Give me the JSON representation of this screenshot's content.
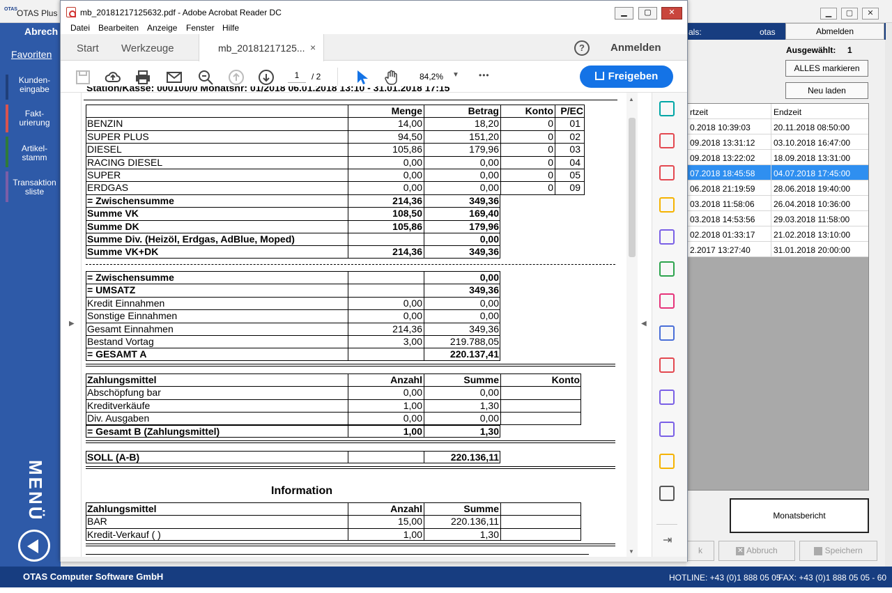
{
  "otas": {
    "window_title": "OTAS Plus",
    "logo_text": "OTAS",
    "section_title": "Abrech",
    "favoriten": "Favoriten",
    "nav": [
      {
        "label": "Kunden-\neingabe",
        "color": "#2e5aa8"
      },
      {
        "label": "Fakt-\nurierung",
        "color": "#d9534f"
      },
      {
        "label": "Artikel-\nstamm",
        "color": "#3c8d3c"
      },
      {
        "label": "Transaktion\nsliste",
        "color": "#7b5ea7"
      }
    ],
    "menu_label": "MENÜ",
    "topbar_als": "als:",
    "topbar_user": "otas",
    "abmelden": "Abmelden",
    "ausgewaehlt_label": "Ausgewählt:",
    "ausgewaehlt_count": "1",
    "alles_markieren": "ALLES markieren",
    "neu_laden": "Neu laden",
    "table_headers": [
      "rtzeit",
      "Endzeit"
    ],
    "table_rows": [
      [
        "0.2018 10:39:03",
        "20.11.2018 08:50:00"
      ],
      [
        "09.2018 13:31:12",
        "03.10.2018 16:47:00"
      ],
      [
        "09.2018 13:22:02",
        "18.09.2018 13:31:00"
      ],
      [
        "07.2018 18:45:58",
        "04.07.2018 17:45:00"
      ],
      [
        "06.2018 21:19:59",
        "28.06.2018 19:40:00"
      ],
      [
        "03.2018 11:58:06",
        "26.04.2018 10:36:00"
      ],
      [
        "03.2018 14:53:56",
        "29.03.2018 11:58:00"
      ],
      [
        "02.2018 01:33:17",
        "21.02.2018 13:10:00"
      ],
      [
        "2.2017 13:27:40",
        "31.01.2018 20:00:00"
      ]
    ],
    "selected_row": 3,
    "monatsbericht": "Monatsbericht",
    "bottom_buttons": [
      "k",
      "Abbruch",
      "Speichern"
    ],
    "company": "OTAS Computer Software GmbH",
    "hotline": "HOTLINE: +43 (0)1 888 05 05",
    "fax": "FAX: +43 (0)1 888 05 05 - 60"
  },
  "acrobat": {
    "title": "mb_20181217125632.pdf - Adobe Acrobat Reader DC",
    "menus": [
      "Datei",
      "Bearbeiten",
      "Anzeige",
      "Fenster",
      "Hilfe"
    ],
    "tabs": {
      "start": "Start",
      "werkzeuge": "Werkzeuge",
      "doc": "mb_20181217125...",
      "close": "×"
    },
    "help": "?",
    "anmelden": "Anmelden",
    "page_current": "1",
    "page_total": "/ 2",
    "zoom": "84,2%",
    "share": "Freigeben",
    "more": "•••"
  },
  "pdf": {
    "cut_header": "Station/Kasse: 000100/0          Monatsnr: 01/2018          06.01.2018 13:10 - 31.01.2018 17:15",
    "t1_headers": {
      "menge": "Menge",
      "betrag": "Betrag",
      "konto": "Konto",
      "pec": "P/EC"
    },
    "t1_rows": [
      {
        "name": "BENZIN",
        "menge": "14,00",
        "betrag": "18,20",
        "konto": "0",
        "pec": "01"
      },
      {
        "name": "SUPER PLUS",
        "menge": "94,50",
        "betrag": "151,20",
        "konto": "0",
        "pec": "02"
      },
      {
        "name": "DIESEL",
        "menge": "105,86",
        "betrag": "179,96",
        "konto": "0",
        "pec": "03"
      },
      {
        "name": "RACING DIESEL",
        "menge": "0,00",
        "betrag": "0,00",
        "konto": "0",
        "pec": "04"
      },
      {
        "name": "SUPER",
        "menge": "0,00",
        "betrag": "0,00",
        "konto": "0",
        "pec": "05"
      },
      {
        "name": "ERDGAS",
        "menge": "0,00",
        "betrag": "0,00",
        "konto": "0",
        "pec": "09"
      }
    ],
    "t1_sums": [
      {
        "name": "= Zwischensumme",
        "menge": "214,36",
        "betrag": "349,36"
      },
      {
        "name": "Summe VK",
        "menge": "108,50",
        "betrag": "169,40"
      },
      {
        "name": "Summe DK",
        "menge": "105,86",
        "betrag": "179,96"
      },
      {
        "name": "Summe Div. (Heizöl, Erdgas, AdBlue, Moped)",
        "menge": "",
        "betrag": "0,00"
      },
      {
        "name": "Summe VK+DK",
        "menge": "214,36",
        "betrag": "349,36"
      }
    ],
    "t2_rows": [
      {
        "name": "= Zwischensumme",
        "menge": "",
        "betrag": "0,00",
        "bold": true
      },
      {
        "name": "= UMSATZ",
        "menge": "",
        "betrag": "349,36",
        "bold": true
      },
      {
        "name": "Kredit Einnahmen",
        "menge": "0,00",
        "betrag": "0,00",
        "bold": false
      },
      {
        "name": "Sonstige Einnahmen",
        "menge": "0,00",
        "betrag": "0,00",
        "bold": false
      },
      {
        "name": "Gesamt Einnahmen",
        "menge": "214,36",
        "betrag": "349,36",
        "bold": false
      },
      {
        "name": "Bestand Vortag",
        "menge": "3,00",
        "betrag": "219.788,05",
        "bold": false
      },
      {
        "name": "= GESAMT A",
        "menge": "",
        "betrag": "220.137,41",
        "bold": true
      }
    ],
    "t3_headers": {
      "name": "Zahlungsmittel",
      "anzahl": "Anzahl",
      "summe": "Summe",
      "konto": "Konto"
    },
    "t3_rows": [
      {
        "name": "Abschöpfung bar",
        "anzahl": "0,00",
        "summe": "0,00"
      },
      {
        "name": "Kreditverkäufe",
        "anzahl": "1,00",
        "summe": "1,30"
      },
      {
        "name": "Div. Ausgaben",
        "anzahl": "0,00",
        "summe": "0,00"
      }
    ],
    "t3_total": {
      "name": "= Gesamt B (Zahlungsmittel)",
      "anzahl": "1,00",
      "summe": "1,30"
    },
    "soll": {
      "name": "SOLL (A-B)",
      "value": "220.136,11"
    },
    "info_title": "Information",
    "t4_headers": {
      "name": "Zahlungsmittel",
      "anzahl": "Anzahl",
      "summe": "Summe"
    },
    "t4_rows": [
      {
        "name": "BAR",
        "anzahl": "15,00",
        "summe": "220.136,11"
      },
      {
        "name": "Kredit-Verkauf   ( )",
        "anzahl": "1,00",
        "summe": "1,30"
      }
    ]
  }
}
